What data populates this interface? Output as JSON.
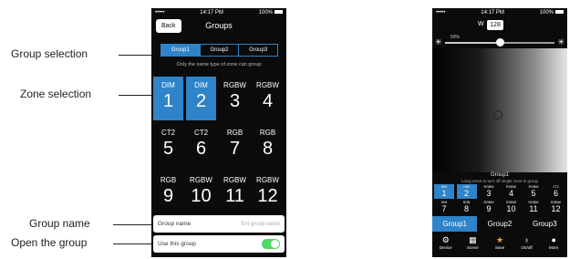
{
  "annotations": {
    "group_selection": "Group selection",
    "zone_selection": "Zone selection",
    "group_name": "Group name",
    "open_group": "Open the group"
  },
  "phone1": {
    "status": {
      "carrier": "•••••  ",
      "time": "14:17 PM",
      "battery": "100%"
    },
    "nav": {
      "back": "Back",
      "title": "Groups"
    },
    "segments": [
      {
        "label": "Group1",
        "active": true
      },
      {
        "label": "Group2",
        "active": false
      },
      {
        "label": "Group3",
        "active": false
      }
    ],
    "hint": "Only the same type of zone can group",
    "zones": [
      {
        "type": "DIM",
        "num": "1",
        "active": true
      },
      {
        "type": "DIM",
        "num": "2",
        "active": true
      },
      {
        "type": "RGBW",
        "num": "3",
        "active": false
      },
      {
        "type": "RGBW",
        "num": "4",
        "active": false
      },
      {
        "type": "CT2",
        "num": "5",
        "active": false
      },
      {
        "type": "CT2",
        "num": "6",
        "active": false
      },
      {
        "type": "RGB",
        "num": "7",
        "active": false
      },
      {
        "type": "RGB",
        "num": "8",
        "active": false
      },
      {
        "type": "RGB",
        "num": "9",
        "active": false
      },
      {
        "type": "RGBW",
        "num": "10",
        "active": false
      },
      {
        "type": "RGBW",
        "num": "11",
        "active": false
      },
      {
        "type": "RGBW",
        "num": "12",
        "active": false
      }
    ],
    "group_name": {
      "label": "Group name",
      "placeholder": "Ent group name"
    },
    "use_group": {
      "label": "Use this group",
      "on": true
    },
    "accent": "#2f83c8"
  },
  "phone2": {
    "status": {
      "carrier": "•••••  ",
      "time": "14:17 PM",
      "battery": "100%"
    },
    "white": {
      "label": "W",
      "value": "128"
    },
    "brightness_pct_label": "50%",
    "brightness_level": 0.5,
    "group_title": "Group1",
    "group_hint": "Long press to turn off single zone in group",
    "mini_zones": [
      {
        "type": "DIM",
        "num": "1",
        "active": true
      },
      {
        "type": "DIM",
        "num": "2",
        "active": true
      },
      {
        "type": "RGBW",
        "num": "3",
        "active": false
      },
      {
        "type": "RGBW",
        "num": "4",
        "active": false
      },
      {
        "type": "RGBW",
        "num": "5",
        "active": false
      },
      {
        "type": "CT2",
        "num": "6",
        "active": false
      },
      {
        "type": "DIM",
        "num": "7",
        "active": false
      },
      {
        "type": "RGB",
        "num": "8",
        "active": false
      },
      {
        "type": "RGBW",
        "num": "9",
        "active": false
      },
      {
        "type": "RGBW",
        "num": "10",
        "active": false
      },
      {
        "type": "RGBW",
        "num": "11",
        "active": false
      },
      {
        "type": "RGBW",
        "num": "12",
        "active": false
      }
    ],
    "group_tabs": [
      {
        "label": "Group1",
        "active": true
      },
      {
        "label": "Group2",
        "active": false
      },
      {
        "label": "Group3",
        "active": false
      }
    ],
    "bottom_bar": [
      {
        "label": "Device",
        "icon": "gear-icon",
        "active": false
      },
      {
        "label": "Scene",
        "icon": "grid-icon",
        "active": false
      },
      {
        "label": "Save",
        "icon": "star-icon",
        "active": true
      },
      {
        "label": "On/off",
        "icon": "bulb-icon",
        "active": false
      },
      {
        "label": "More",
        "icon": "more-icon",
        "active": false
      }
    ]
  }
}
